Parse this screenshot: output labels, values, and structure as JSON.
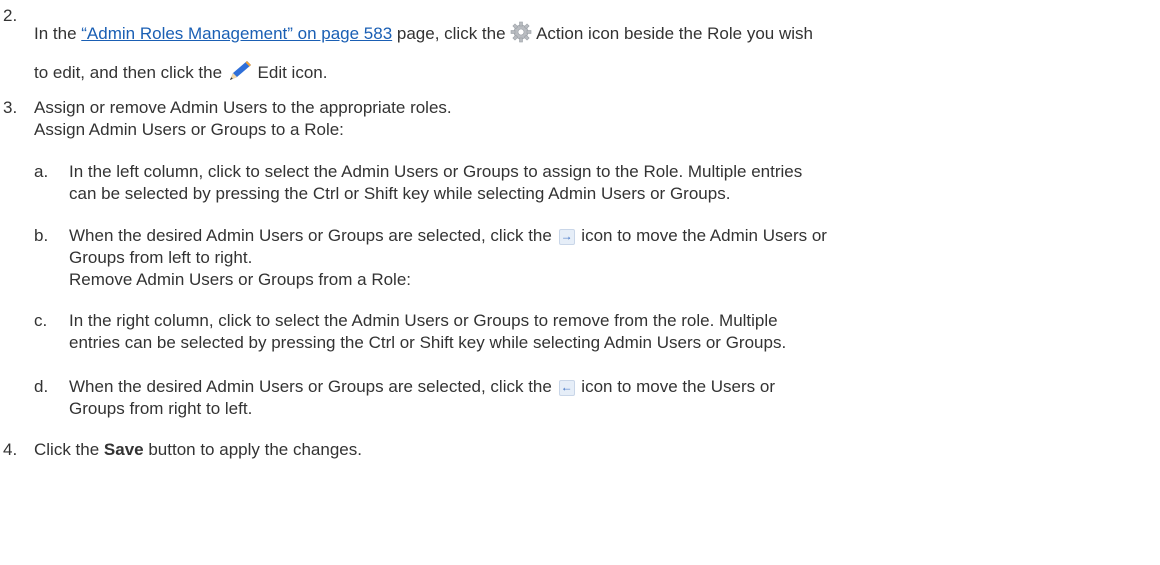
{
  "steps": {
    "s2": {
      "number": "2.",
      "t1": "In the ",
      "link": "“Admin Roles Management” on page 583",
      "t2": " page, click the ",
      "t3": " Action icon beside the Role you wish",
      "t4": "to edit, and then click the ",
      "t5": " Edit icon."
    },
    "s3": {
      "number": "3.",
      "line1": "Assign or remove Admin Users to the appropriate roles.",
      "line2": "Assign Admin Users or Groups to a Role:"
    },
    "sa": {
      "letter": "a.",
      "line1": "In the left column, click to select the Admin Users or Groups to assign to the Role. Multiple entries",
      "line2": "can be selected by pressing the Ctrl or Shift key while selecting Admin Users or Groups."
    },
    "sb": {
      "letter": "b.",
      "t1": "When the desired Admin Users or Groups are selected, click the ",
      "t2": " icon to move the Admin Users or",
      "line2": "Groups from left to right.",
      "line3": "Remove Admin Users or Groups from a Role:"
    },
    "sc": {
      "letter": "c.",
      "line1": "In the right column, click to select the Admin Users or Groups to remove from the role. Multiple",
      "line2": "entries can be selected by pressing the Ctrl or Shift key while selecting Admin Users or Groups."
    },
    "sd": {
      "letter": "d.",
      "t1": "When the desired Admin Users or Groups are selected, click the ",
      "t2": " icon to move the Users or",
      "line2": "Groups from right to left."
    },
    "s4": {
      "number": "4.",
      "t1": "Click the ",
      "bold": "Save",
      "t2": " button to apply the changes."
    }
  },
  "icons": {
    "action": "gear-icon",
    "edit": "pencil-icon",
    "move_right": "arrow-right-icon",
    "move_left": "arrow-left-icon"
  },
  "arrows": {
    "right": "→",
    "left": "←"
  },
  "colors": {
    "text": "#333333",
    "link": "#1a5fb4"
  }
}
